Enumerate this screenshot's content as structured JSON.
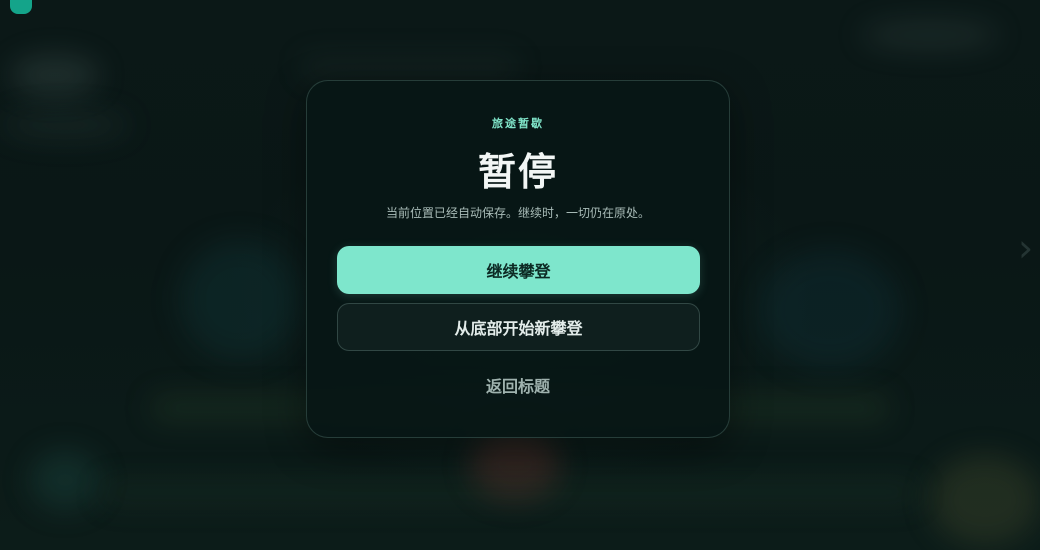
{
  "pause_menu": {
    "eyebrow": "旅途暂歇",
    "title": "暂停",
    "subtitle": "当前位置已经自动保存。继续时，一切仍在原处。",
    "buttons": {
      "continue_label": "继续攀登",
      "restart_label": "从底部开始新攀登",
      "title_label": "返回标题"
    }
  },
  "colors": {
    "accent": "#7ee6cc",
    "panel": "#071615",
    "background": "#0b1817"
  },
  "icons": {
    "corner": "app-badge-icon",
    "side_nav": "chevron-right-icon"
  }
}
